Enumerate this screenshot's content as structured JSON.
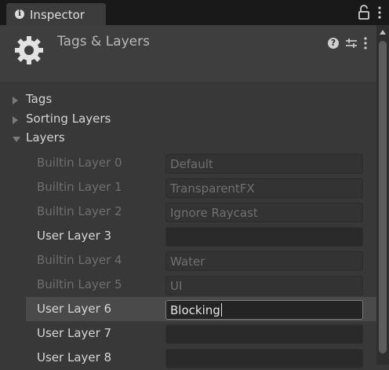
{
  "window": {
    "tab_label": "Inspector",
    "lock_icon": "lock-icon",
    "menu_icon": "kebab-icon"
  },
  "header": {
    "title": "Tags & Layers",
    "icon": "gear-icon",
    "help_icon": "help-icon",
    "presets_icon": "presets-icon",
    "menu_icon": "kebab-icon"
  },
  "foldouts": [
    {
      "label": "Tags",
      "expanded": false
    },
    {
      "label": "Sorting Layers",
      "expanded": false
    },
    {
      "label": "Layers",
      "expanded": true
    }
  ],
  "layers": [
    {
      "name": "Builtin Layer 0",
      "value": "Default",
      "kind": "builtin",
      "editable": false
    },
    {
      "name": "Builtin Layer 1",
      "value": "TransparentFX",
      "kind": "builtin",
      "editable": false
    },
    {
      "name": "Builtin Layer 2",
      "value": "Ignore Raycast",
      "kind": "builtin",
      "editable": false
    },
    {
      "name": "User Layer 3",
      "value": "",
      "kind": "user",
      "editable": true
    },
    {
      "name": "Builtin Layer 4",
      "value": "Water",
      "kind": "builtin",
      "editable": false
    },
    {
      "name": "Builtin Layer 5",
      "value": "UI",
      "kind": "builtin",
      "editable": false
    },
    {
      "name": "User Layer 6",
      "value": "Blocking",
      "kind": "user",
      "editable": true,
      "focused": true
    },
    {
      "name": "User Layer 7",
      "value": "",
      "kind": "user",
      "editable": true
    },
    {
      "name": "User Layer 8",
      "value": "",
      "kind": "user",
      "editable": true
    }
  ],
  "colors": {
    "background": "#383838",
    "tab_bar": "#191919",
    "selected_row": "#4a4a4a",
    "disabled_text": "#6e6e6e"
  }
}
